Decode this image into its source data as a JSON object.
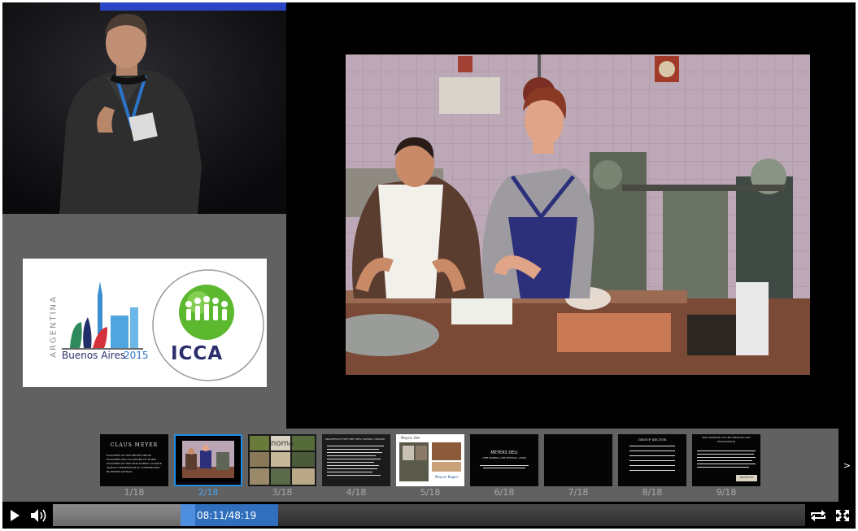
{
  "player": {
    "progress_fraction": 0.1697,
    "time_display": "08:11/48:19",
    "next_label": ">"
  },
  "logo": {
    "country_text": "ARGENTINA",
    "city_text": "Buenos Aires",
    "year_text": "2015",
    "org_text": "ICCA"
  },
  "thumbnails": [
    {
      "label": "1/18",
      "active": false,
      "title": "CLAUS MEYER",
      "lines": [
        "FOUNDER OF THE MEYER GROUP",
        "FOUNDER AND CO-OWNER OF NOMA",
        "FOUNDER OF THE NEW NORDIC CUISINE",
        "ADJUNCT PROFESSOR AT COPENHAGEN",
        "BUSINESS SCHOOL"
      ]
    },
    {
      "label": "2/18",
      "active": true
    },
    {
      "label": "3/18",
      "active": false,
      "title": "noma"
    },
    {
      "label": "4/18",
      "active": false,
      "title": "MANIFESTO FOR THE NEW NORDIC CUISINE"
    },
    {
      "label": "5/18",
      "active": false,
      "title": "Meyers Deli",
      "caption": "Meyers Bageri"
    },
    {
      "label": "6/18",
      "active": false,
      "title": "MEYERS DELI",
      "subtitle": "(THE NORMAL LIFE FESTIVAL, 2006)"
    },
    {
      "label": "7/18",
      "active": false
    },
    {
      "label": "8/18",
      "active": false,
      "title": "GROUP SECTOR"
    },
    {
      "label": "9/18",
      "active": false,
      "title": "THE PURPOSE OF THE MELTING POT FOUNDATION",
      "caption": "MELTING POT"
    }
  ],
  "colors": {
    "accent": "#1e8fe8",
    "time_box": "#2f6fbd",
    "icca_green": "#5cb82e",
    "icca_text": "#2a2f6b"
  },
  "icons": {
    "play": "play-icon",
    "volume": "volume-icon",
    "loop": "loop-icon",
    "fullscreen": "fullscreen-icon"
  }
}
